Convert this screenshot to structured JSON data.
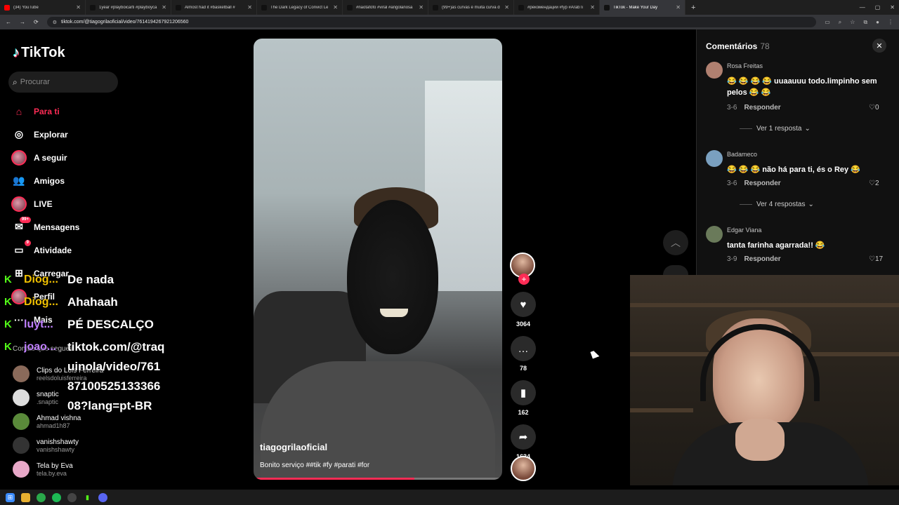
{
  "browser": {
    "tabs": [
      {
        "title": "(34) YouTube",
        "color": "#ff0000",
        "active": false
      },
      {
        "title": "1year #playboicarti #playboyca",
        "color": "#111111",
        "active": false
      },
      {
        "title": "Almost had it #basketball #",
        "color": "#111111",
        "active": false
      },
      {
        "title": "The Dark Legacy of Convict Le",
        "color": "#111111",
        "active": false
      },
      {
        "title": "#naotafofo #viral #angolanosa",
        "color": "#111111",
        "active": false
      },
      {
        "title": "(99+)as curvas é muita curva d",
        "color": "#111111",
        "active": false
      },
      {
        "title": "#рекомендации #fyp #ArabTi",
        "color": "#111111",
        "active": false
      },
      {
        "title": "TikTok - Make Your Day",
        "color": "#111111",
        "active": true
      }
    ],
    "new_tab": "+",
    "url": "tiktok.com/@tiagogrilaoficial/video/7614194267921206560"
  },
  "sidebar": {
    "logo": "TikTok",
    "search_placeholder": "Procurar",
    "nav": [
      {
        "label": "Para ti",
        "icon": "home-icon",
        "glyph": "⌂",
        "active": true,
        "badge": ""
      },
      {
        "label": "Explorar",
        "icon": "compass-icon",
        "glyph": "◎",
        "active": false,
        "badge": ""
      },
      {
        "label": "A seguir",
        "icon": "following-avatar-icon",
        "glyph": "",
        "active": false,
        "badge": ""
      },
      {
        "label": "Amigos",
        "icon": "friends-icon",
        "glyph": "👥",
        "active": false,
        "badge": ""
      },
      {
        "label": "LIVE",
        "icon": "live-avatar-icon",
        "glyph": "",
        "active": false,
        "badge": ""
      },
      {
        "label": "Mensagens",
        "icon": "messages-icon",
        "glyph": "✉",
        "active": false,
        "badge": "99+"
      },
      {
        "label": "Atividade",
        "icon": "activity-icon",
        "glyph": "▭",
        "active": false,
        "badge": "9"
      },
      {
        "label": "Carregar",
        "icon": "upload-icon",
        "glyph": "⊞",
        "active": false,
        "badge": ""
      },
      {
        "label": "Perfil",
        "icon": "profile-icon",
        "glyph": "",
        "active": false,
        "badge": ""
      },
      {
        "label": "Mais",
        "icon": "more-icon",
        "glyph": "···",
        "active": false,
        "badge": ""
      }
    ],
    "following_title": "Contas que segues",
    "following": [
      {
        "name": "Clips do Lois Ferreira",
        "handle": "reelsdoluisferreira",
        "color": "#8a6a5a"
      },
      {
        "name": "snaptic",
        "handle": ".snaptic",
        "color": "#dddddd"
      },
      {
        "name": "Ahmad vishna",
        "handle": "ahmad1h87",
        "color": "#5a8a3a"
      },
      {
        "name": "vanishshawty",
        "handle": "vanishshawty",
        "color": "#333333"
      },
      {
        "name": "Tela by Eva",
        "handle": "tela.by.eva",
        "color": "#e8a8c8"
      }
    ]
  },
  "chat": [
    {
      "user": "Diog...",
      "color": "#f0c000",
      "message": "De nada"
    },
    {
      "user": "Diog...",
      "color": "#f0c000",
      "message": "Ahahaah"
    },
    {
      "user": "luyt...",
      "color": "#c080ff",
      "message": "PÉ DESCALÇO"
    },
    {
      "user": "joao...",
      "color": "#c080ff",
      "message": "tiktok.com/@traquinola/video/7618710052513336608?lang=pt-BR"
    }
  ],
  "video": {
    "author": "tiagogrilaoficial",
    "caption": "Bonito serviço ##tik #fy #parati #for",
    "progress": 0.65
  },
  "actions": {
    "likes": "3064",
    "comments": "78",
    "saves": "162",
    "shares": "1634"
  },
  "comments_panel": {
    "title": "Comentários",
    "count": "78",
    "items": [
      {
        "name": "Rosa Freitas",
        "text": "😂 😂 😂 😂 uuaauuu todo.limpinho sem pelos 😂 😂",
        "date": "3-6",
        "reply": "Responder",
        "likes": "0",
        "more": "Ver 1 resposta",
        "avatar": "#b08070"
      },
      {
        "name": "Badameco",
        "text": "😂 😂 😂 não há para ti, és o Rey 😂",
        "date": "3-6",
        "reply": "Responder",
        "likes": "2",
        "more": "Ver 4 respostas",
        "avatar": "#7aa0c0"
      },
      {
        "name": "Edgar Viana",
        "text": "tanta farinha agarrada!! 😂",
        "date": "3-9",
        "reply": "Responder",
        "likes": "17",
        "more": "",
        "avatar": "#6a7a5a"
      }
    ]
  },
  "colors": {
    "accent": "#fe2c55",
    "kick_green": "#53fc18"
  }
}
